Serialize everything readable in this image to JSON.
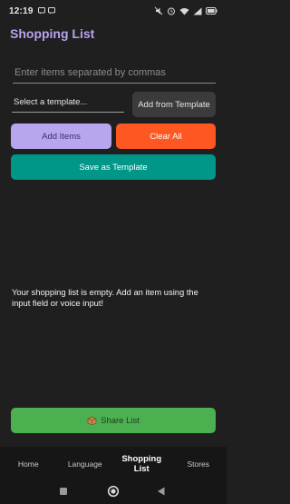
{
  "status_bar": {
    "time": "12:19",
    "left_icons": [
      "message-icon",
      "message-icon"
    ],
    "right_icons": [
      "mute-icon",
      "alarm-icon",
      "wifi-icon",
      "signal-icon",
      "battery-icon"
    ]
  },
  "app": {
    "title": "Shopping List"
  },
  "items_input": {
    "value": "",
    "placeholder": "Enter items separated by commas"
  },
  "template": {
    "select_label": "Select a template...",
    "add_from_template_label": "Add from Template"
  },
  "actions": {
    "add_items_label": "Add Items",
    "clear_all_label": "Clear All",
    "save_template_label": "Save as Template"
  },
  "empty_state": {
    "message": "Your shopping list is empty. Add an item using the input field or voice input!"
  },
  "share": {
    "icon": "package-icon",
    "label": "Share List"
  },
  "bottom_nav": {
    "items": [
      {
        "label": "Home"
      },
      {
        "label": "Language"
      },
      {
        "label": "Shopping List"
      },
      {
        "label": "Stores"
      }
    ],
    "active_index": 2
  },
  "system_nav": {
    "buttons": [
      "recents-icon",
      "home-icon",
      "back-icon"
    ]
  },
  "colors": {
    "background": "#1f1f1f",
    "title": "#b7a3ee",
    "add_items": "#b7a5ee",
    "clear_all": "#ff5722",
    "save_template": "#009688",
    "share": "#4caf50",
    "add_from_template": "#3b3b3b"
  }
}
